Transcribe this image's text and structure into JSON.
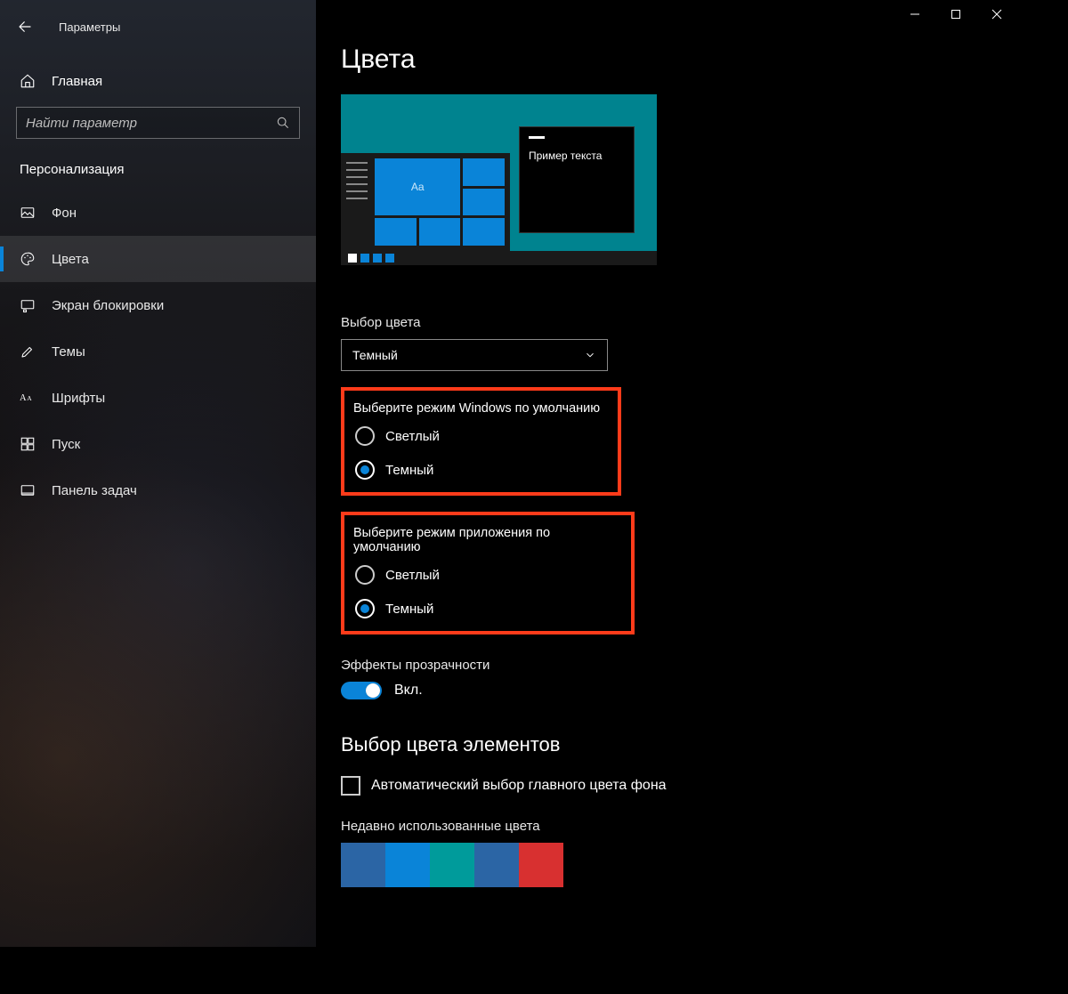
{
  "window": {
    "title": "Параметры"
  },
  "sidebar": {
    "home": "Главная",
    "search_placeholder": "Найти параметр",
    "category": "Персонализация",
    "items": [
      {
        "label": "Фон",
        "icon": "image"
      },
      {
        "label": "Цвета",
        "icon": "palette",
        "active": true
      },
      {
        "label": "Экран блокировки",
        "icon": "lock-screen"
      },
      {
        "label": "Темы",
        "icon": "brush"
      },
      {
        "label": "Шрифты",
        "icon": "font"
      },
      {
        "label": "Пуск",
        "icon": "start"
      },
      {
        "label": "Панель задач",
        "icon": "taskbar"
      }
    ]
  },
  "main": {
    "title": "Цвета",
    "preview": {
      "sample_text": "Пример текста",
      "tile_label": "Aa"
    },
    "color_choice": {
      "label": "Выбор цвета",
      "value": "Темный"
    },
    "windows_mode": {
      "label": "Выберите режим Windows по умолчанию",
      "options": {
        "light": "Светлый",
        "dark": "Темный"
      },
      "selected": "dark"
    },
    "app_mode": {
      "label": "Выберите режим приложения по умолчанию",
      "options": {
        "light": "Светлый",
        "dark": "Темный"
      },
      "selected": "dark"
    },
    "transparency": {
      "label": "Эффекты прозрачности",
      "state": "Вкл."
    },
    "accent": {
      "heading": "Выбор цвета элементов",
      "auto_label": "Автоматический выбор главного цвета фона",
      "recent_label": "Недавно использованные цвета",
      "recent_colors": [
        "#2b65a5",
        "#0a84d8",
        "#009b9b",
        "#2b65a5",
        "#d83030"
      ]
    }
  }
}
